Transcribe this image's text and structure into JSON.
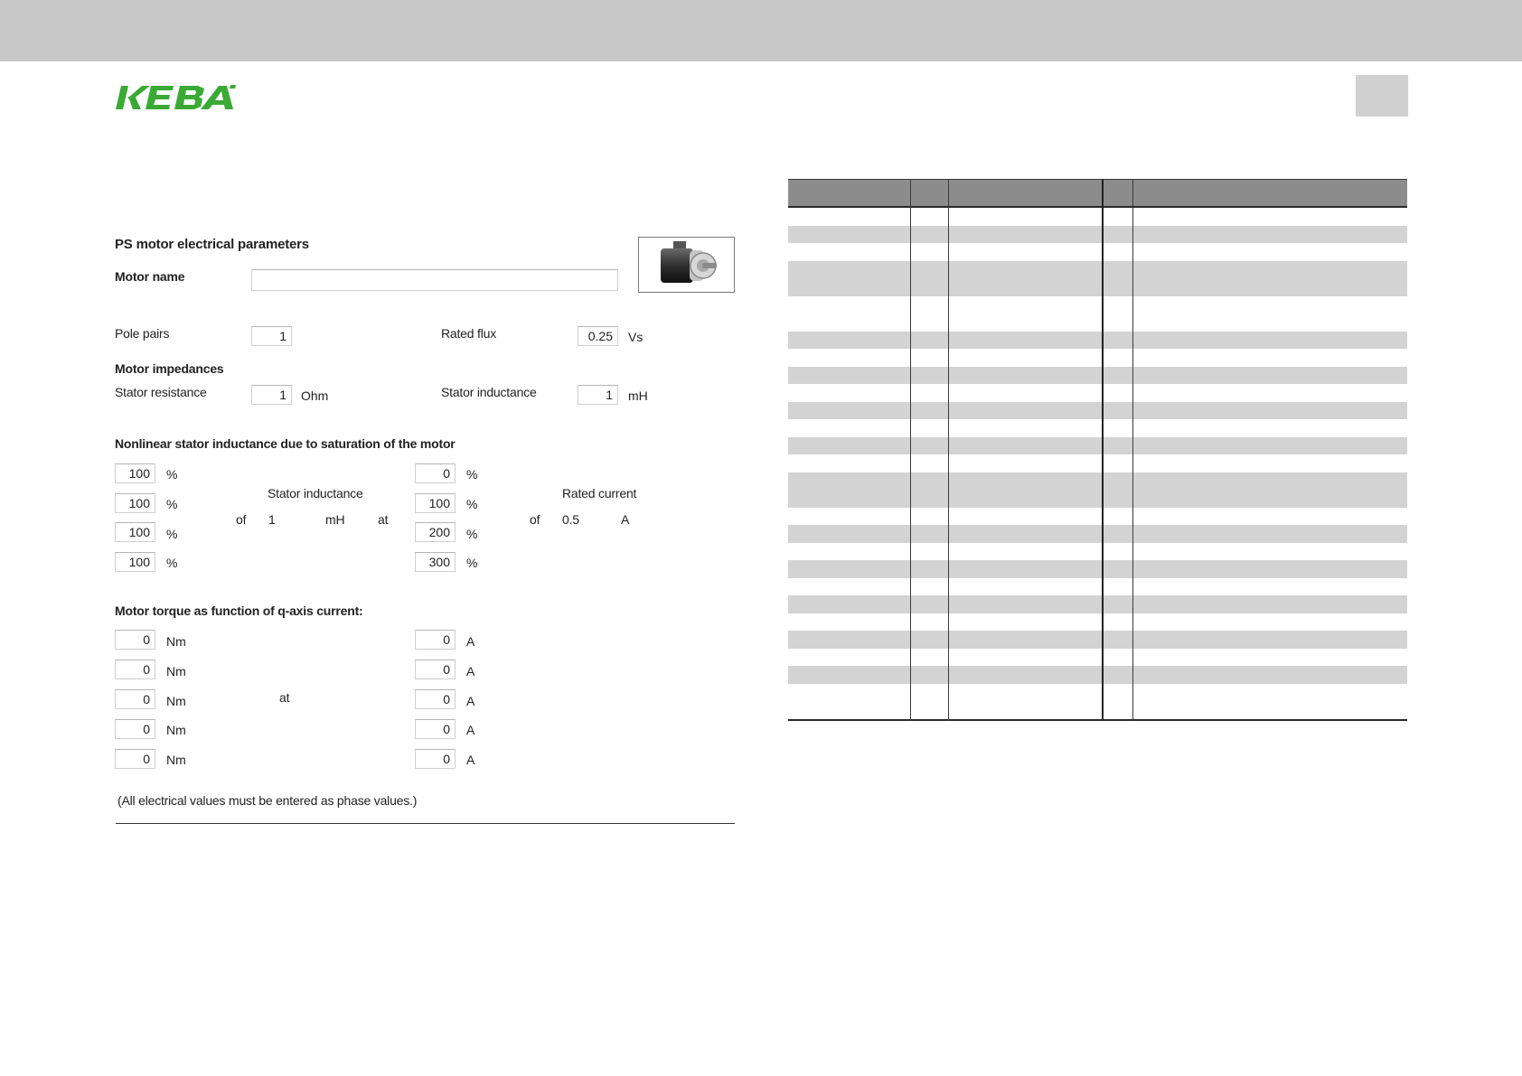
{
  "brand": {
    "logo_text": "KEBA",
    "logo_color": "#3aaa35"
  },
  "form": {
    "section_title": "PS motor electrical parameters",
    "motor_name": {
      "label": "Motor name",
      "value": ""
    },
    "pole_pairs": {
      "label": "Pole pairs",
      "value": "1"
    },
    "rated_flux": {
      "label": "Rated flux",
      "value": "0.25",
      "unit": "Vs"
    },
    "impedances_title": "Motor impedances",
    "stator_resistance": {
      "label": "Stator resistance",
      "value": "1",
      "unit": "Ohm"
    },
    "stator_inductance": {
      "label": "Stator inductance",
      "value": "1",
      "unit": "mH"
    },
    "nonlinear": {
      "title": "Nonlinear stator inductance due to saturation of the motor",
      "percent_unit": "%",
      "inductance_percent": [
        "100",
        "100",
        "100",
        "100"
      ],
      "current_percent": [
        "0",
        "100",
        "200",
        "300"
      ],
      "stator_inductance_label": "Stator inductance",
      "of_label": "of",
      "stator_inductance_value": "1",
      "stator_inductance_unit": "mH",
      "at_label": "at",
      "rated_current_label": "Rated current",
      "rated_current_of": "of",
      "rated_current_value": "0.5",
      "rated_current_unit": "A"
    },
    "torque": {
      "title": "Motor torque as function of q-axis current:",
      "torque_values": [
        "0",
        "0",
        "0",
        "0",
        "0"
      ],
      "torque_unit": "Nm",
      "current_values": [
        "0",
        "0",
        "0",
        "0",
        "0"
      ],
      "current_unit": "A",
      "at_label": "at"
    },
    "footnote": "(All electrical values must be entered as phase values.)"
  },
  "table": {
    "rows": [
      {
        "fill": "white"
      },
      {
        "fill": "gray"
      },
      {
        "fill": "white"
      },
      {
        "fill": "gray",
        "tall": true
      },
      {
        "fill": "white",
        "tall": true
      },
      {
        "fill": "gray"
      },
      {
        "fill": "white"
      },
      {
        "fill": "gray"
      },
      {
        "fill": "white"
      },
      {
        "fill": "gray"
      },
      {
        "fill": "white"
      },
      {
        "fill": "gray"
      },
      {
        "fill": "white"
      },
      {
        "fill": "gray",
        "tall": true
      },
      {
        "fill": "white"
      },
      {
        "fill": "gray"
      },
      {
        "fill": "white"
      },
      {
        "fill": "gray"
      },
      {
        "fill": "white"
      },
      {
        "fill": "gray"
      },
      {
        "fill": "white"
      },
      {
        "fill": "gray"
      },
      {
        "fill": "white"
      },
      {
        "fill": "gray"
      },
      {
        "fill": "white",
        "tall": true
      }
    ]
  }
}
